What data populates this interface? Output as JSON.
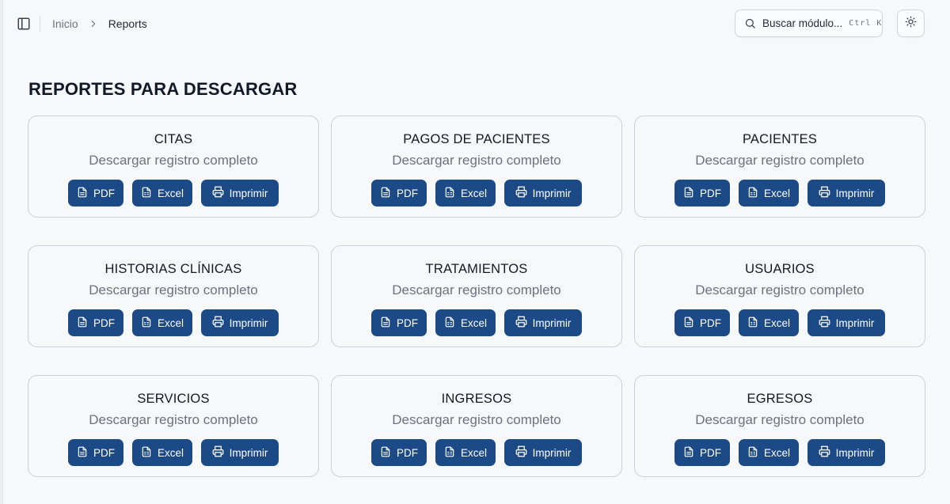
{
  "breadcrumb": {
    "home": "Inicio",
    "current": "Reports"
  },
  "search": {
    "placeholder": "Buscar módulo...",
    "shortcut": "Ctrl K"
  },
  "page": {
    "title": "REPORTES PARA DESCARGAR"
  },
  "reports": [
    {
      "title": "CITAS",
      "subtitle": "Descargar registro completo",
      "pdf": "PDF",
      "excel": "Excel",
      "print": "Imprimir"
    },
    {
      "title": "PAGOS DE PACIENTES",
      "subtitle": "Descargar registro completo",
      "pdf": "PDF",
      "excel": "Excel",
      "print": "Imprimir"
    },
    {
      "title": "PACIENTES",
      "subtitle": "Descargar registro completo",
      "pdf": "PDF",
      "excel": "Excel",
      "print": "Imprimir"
    },
    {
      "title": "HISTORIAS CLÍNICAS",
      "subtitle": "Descargar registro completo",
      "pdf": "PDF",
      "excel": "Excel",
      "print": "Imprimir"
    },
    {
      "title": "TRATAMIENTOS",
      "subtitle": "Descargar registro completo",
      "pdf": "PDF",
      "excel": "Excel",
      "print": "Imprimir"
    },
    {
      "title": "USUARIOS",
      "subtitle": "Descargar registro completo",
      "pdf": "PDF",
      "excel": "Excel",
      "print": "Imprimir"
    },
    {
      "title": "SERVICIOS",
      "subtitle": "Descargar registro completo",
      "pdf": "PDF",
      "excel": "Excel",
      "print": "Imprimir"
    },
    {
      "title": "INGRESOS",
      "subtitle": "Descargar registro completo",
      "pdf": "PDF",
      "excel": "Excel",
      "print": "Imprimir"
    },
    {
      "title": "EGRESOS",
      "subtitle": "Descargar registro completo",
      "pdf": "PDF",
      "excel": "Excel",
      "print": "Imprimir"
    }
  ],
  "icons": {
    "sidebar_toggle": "sidebar-toggle-icon",
    "chevron": "chevron-right-icon",
    "search": "search-icon",
    "theme": "sun-icon",
    "pdf": "file-text-icon",
    "excel": "file-spreadsheet-icon",
    "print": "printer-icon"
  },
  "colors": {
    "button_bg": "#1c4a86",
    "button_text": "#ffffff",
    "card_border": "#c8d1de",
    "page_bg": "#f7f8fa",
    "subtitle": "#6b7280"
  }
}
